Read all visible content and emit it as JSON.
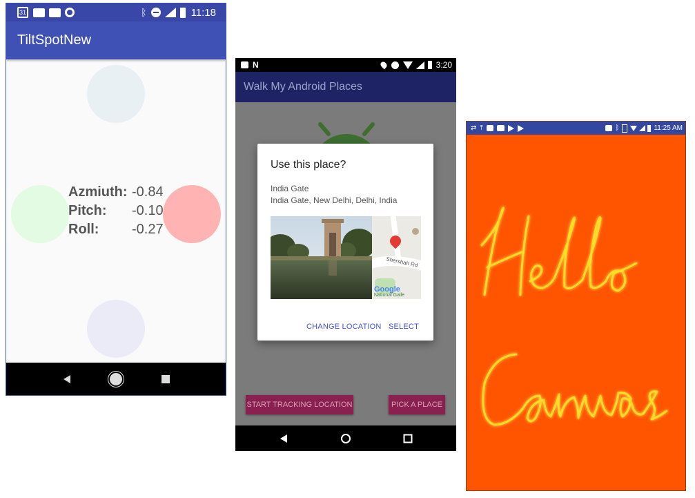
{
  "phone1": {
    "status": {
      "time": "11:18",
      "calendar_day": "31"
    },
    "app_title": "TiltSpotNew",
    "readings": [
      {
        "label": "Azmiuth:",
        "value": "-0.84"
      },
      {
        "label": "Pitch:",
        "value": "-0.10"
      },
      {
        "label": "Roll:",
        "value": "-0.27"
      }
    ],
    "spot_colors": {
      "top": "#e8f0f4",
      "left": "#e3fae3",
      "right": "#ffb3b3",
      "bottom": "#ebebf8"
    },
    "nav": [
      "back-icon",
      "home-icon",
      "recents-icon"
    ]
  },
  "phone2": {
    "status": {
      "time": "3:20"
    },
    "app_title": "Walk My Android Places",
    "dialog": {
      "title": "Use this place?",
      "place_name": "India Gate",
      "place_address": "India Gate, New Delhi, Delhi, India",
      "map_street": "Shershah Rd",
      "map_brand": "Google",
      "map_poi": "National Galle",
      "change_label": "CHANGE LOCATION",
      "select_label": "SELECT"
    },
    "buttons": {
      "start_tracking": "START TRACKING LOCATION",
      "pick_place": "PICK A PLACE"
    },
    "accent": "#3f51d5"
  },
  "phone3": {
    "status": {
      "time": "11:25 AM"
    },
    "canvas_color": "#ff5500",
    "stroke_color": "#ffdd22",
    "drawn_text": [
      "Hello",
      "Canvas"
    ]
  }
}
